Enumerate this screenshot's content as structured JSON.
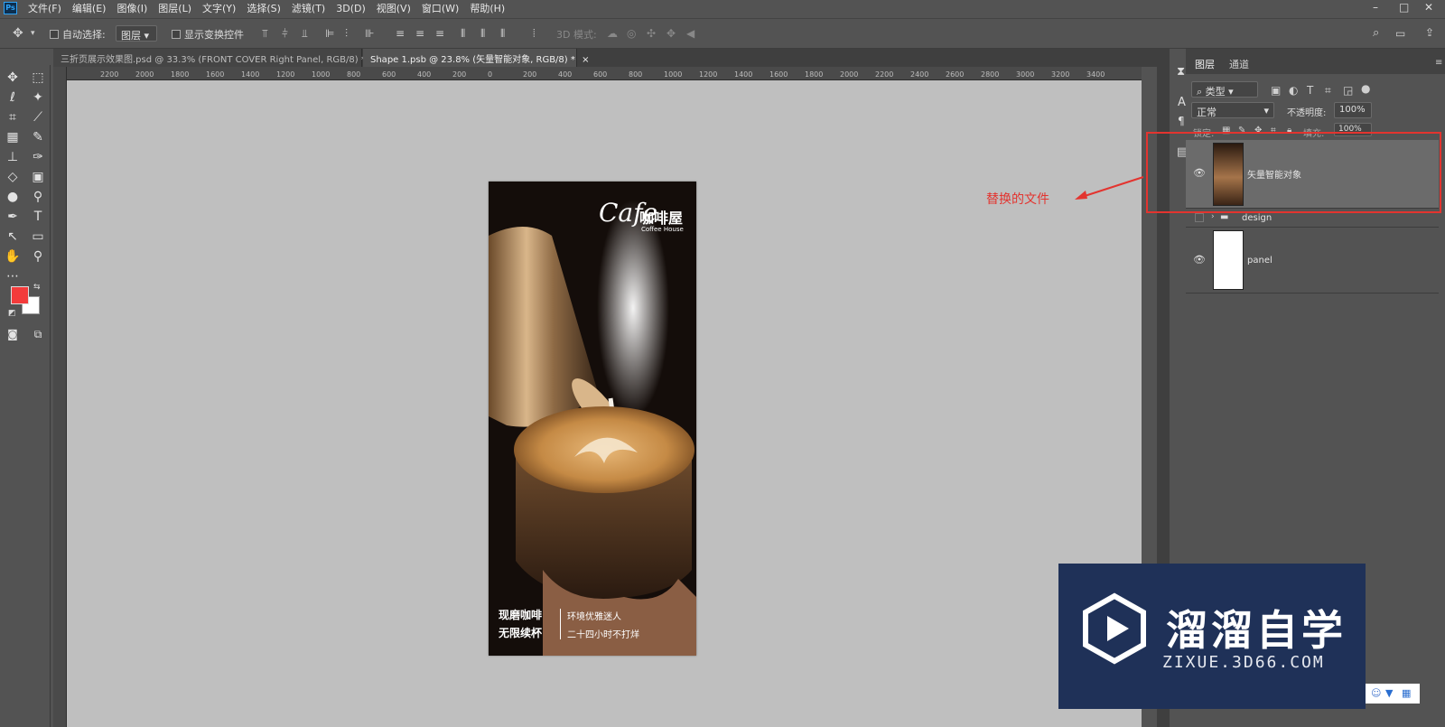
{
  "app": {
    "logo": "Ps"
  },
  "menu": [
    "文件(F)",
    "编辑(E)",
    "图像(I)",
    "图层(L)",
    "文字(Y)",
    "选择(S)",
    "滤镜(T)",
    "3D(D)",
    "视图(V)",
    "窗口(W)",
    "帮助(H)"
  ],
  "window_controls": {
    "minimize": "–",
    "maximize": "□",
    "close": "✕"
  },
  "options": {
    "auto_select_label": "自动选择:",
    "auto_select_value": "图层",
    "show_transform_label": "显示变换控件",
    "mode_3d_label": "3D 模式:"
  },
  "tabs": [
    {
      "label": "三折页展示效果图.psd @ 33.3% (FRONT COVER Right Panel, RGB/8) *",
      "close": "×"
    },
    {
      "label": "Shape 1.psb @ 23.8% (矢量智能对象, RGB/8) *",
      "close": "×"
    }
  ],
  "ruler_h": [
    "2200",
    "2000",
    "1800",
    "1600",
    "1400",
    "1200",
    "1000",
    "800",
    "600",
    "400",
    "200",
    "0",
    "200",
    "400",
    "600",
    "800",
    "1000",
    "1200",
    "1400",
    "1600",
    "1800",
    "2000",
    "2200",
    "2400",
    "2600",
    "2800",
    "3000",
    "3200",
    "3400"
  ],
  "colors": {
    "foreground": "#f33b3b",
    "background": "#ffffff",
    "annotation": "#e3342f",
    "watermark_bg": "#1f3158"
  },
  "artwork": {
    "logo_script": "Cafe",
    "logo_cn": "咖啡屋",
    "logo_en": "Coffee House",
    "slogan_left_1": "现磨咖啡",
    "slogan_left_2": "无限续杯",
    "slogan_right_1": "环境优雅迷人",
    "slogan_right_2": "二十四小时不打烊"
  },
  "layers_panel": {
    "tab_layers": "图层",
    "tab_channels": "通道",
    "filter_kind": "类型",
    "blend_mode": "正常",
    "opacity_label": "不透明度:",
    "opacity_value": "100%",
    "lock_label": "锁定:",
    "fill_label": "填充:",
    "fill_value": "100%",
    "layers": [
      {
        "name": "矢量智能对象",
        "visible": true,
        "selected": true
      },
      {
        "name": "design",
        "visible": false,
        "group": true
      },
      {
        "name": "panel",
        "visible": true
      }
    ]
  },
  "annotation": {
    "text": "替换的文件"
  },
  "watermark": {
    "title": "溜溜自学",
    "subtitle": "ZIXUE.3D66.COM"
  }
}
